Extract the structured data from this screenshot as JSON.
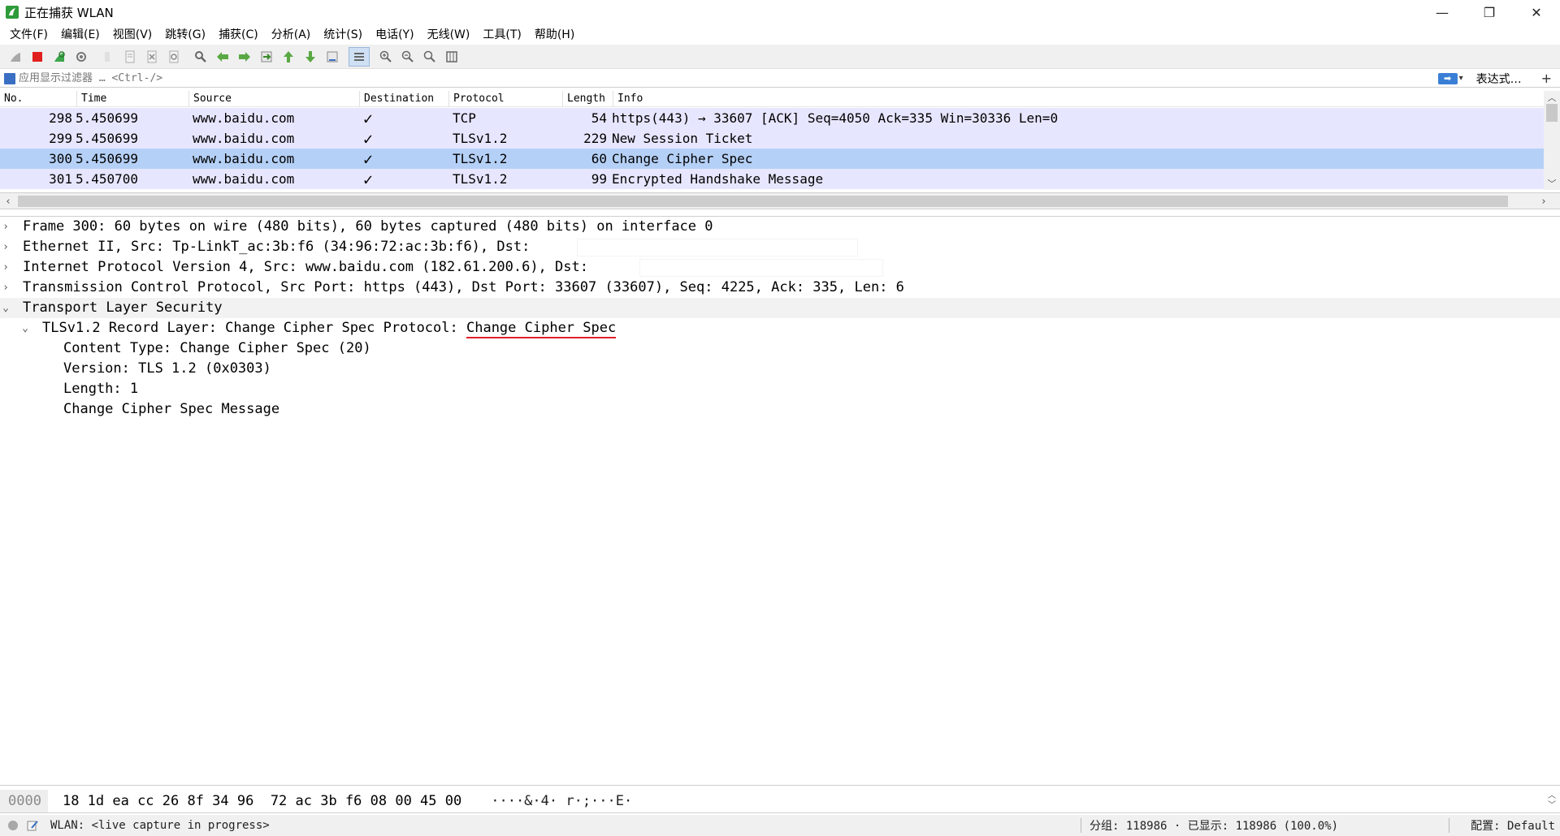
{
  "window": {
    "title": "正在捕获 WLAN",
    "minimize": "—",
    "restore": "❐",
    "close": "✕"
  },
  "menu": [
    "文件(F)",
    "编辑(E)",
    "视图(V)",
    "跳转(G)",
    "捕获(C)",
    "分析(A)",
    "统计(S)",
    "电话(Y)",
    "无线(W)",
    "工具(T)",
    "帮助(H)"
  ],
  "toolbar": {
    "icons": [
      "shark-fin-start-icon",
      "stop-capture-icon",
      "restart-capture-icon",
      "capture-options-icon",
      "open-file-icon",
      "save-file-icon",
      "close-file-icon",
      "reload-file-icon",
      "find-packet-icon",
      "go-back-icon",
      "go-forward-icon",
      "go-to-packet-icon",
      "go-first-icon",
      "go-last-icon",
      "autoscroll-icon",
      "colorize-icon",
      "zoom-in-icon",
      "zoom-out-icon",
      "zoom-normal-icon",
      "resize-columns-icon"
    ]
  },
  "filter": {
    "placeholder": "应用显示过滤器 … <Ctrl-/>",
    "apply_symbol": "➡",
    "dropdown": "▾",
    "expression_label": "表达式…",
    "add_label": "+"
  },
  "packet_list": {
    "columns": [
      "No.",
      "Time",
      "Source",
      "Destination",
      "Protocol",
      "Length",
      "Info"
    ],
    "rows": [
      {
        "no": "298",
        "time": "5.450699",
        "source": "www.baidu.com",
        "destination": "✓",
        "protocol": "TCP",
        "length": "54",
        "info": "https(443) → 33607 [ACK] Seq=4050 Ack=335 Win=30336 Len=0"
      },
      {
        "no": "299",
        "time": "5.450699",
        "source": "www.baidu.com",
        "destination": "✓",
        "protocol": "TLSv1.2",
        "length": "229",
        "info": "New Session Ticket"
      },
      {
        "no": "300",
        "time": "5.450699",
        "source": "www.baidu.com",
        "destination": "✓",
        "protocol": "TLSv1.2",
        "length": "60",
        "info": "Change Cipher Spec"
      },
      {
        "no": "301",
        "time": "5.450700",
        "source": "www.baidu.com",
        "destination": "✓",
        "protocol": "TLSv1.2",
        "length": "99",
        "info": "Encrypted Handshake Message"
      }
    ],
    "selected_index": 2
  },
  "details": {
    "frame": "Frame 300: 60 bytes on wire (480 bits), 60 bytes captured (480 bits) on interface 0",
    "ethernet": "Ethernet II, Src: Tp-LinkT_ac:3b:f6 (34:96:72:ac:3b:f6), Dst:",
    "ip": "Internet Protocol Version 4, Src: www.baidu.com (182.61.200.6), Dst:",
    "tcp": "Transmission Control Protocol, Src Port: https (443), Dst Port: 33607 (33607), Seq: 4225, Ack: 335, Len: 6",
    "tls": "Transport Layer Security",
    "record_prefix": "TLSv1.2 Record Layer: Change Cipher Spec Protocol: ",
    "record_highlight": "Change Cipher Spec",
    "content_type": "Content Type: Change Cipher Spec (20)",
    "version": "Version: TLS 1.2 (0x0303)",
    "length": "Length: 1",
    "message": "Change Cipher Spec Message",
    "collapsed_glyph": "›",
    "expanded_glyph": "⌄"
  },
  "bytes": {
    "offset": "0000",
    "hex": "18 1d ea cc 26 8f 34 96  72 ac 3b f6 08 00 45 00",
    "ascii": "····&·4· r·;···E·"
  },
  "status": {
    "capture": "WLAN: <live capture in progress>",
    "stats": "分组: 118986 · 已显示: 118986 (100.0%)",
    "profile": "配置: Default"
  }
}
